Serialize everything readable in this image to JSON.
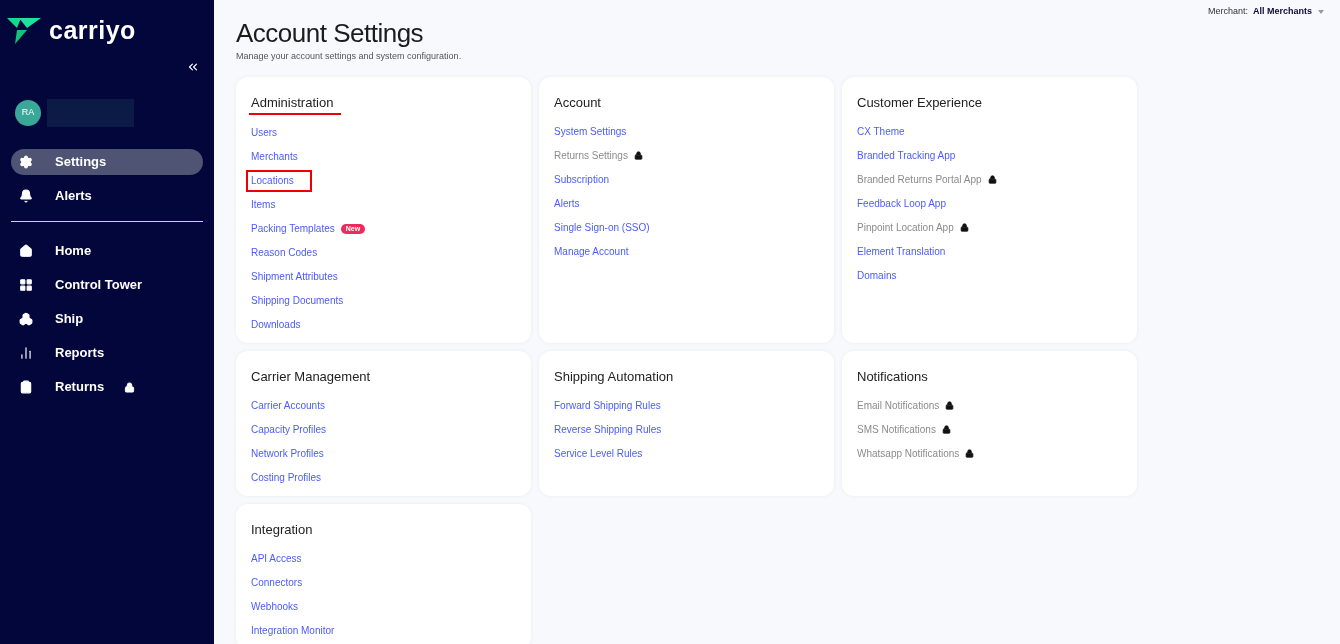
{
  "sidebar": {
    "logo": "carriyo",
    "user": {
      "initials": "RA"
    },
    "top_items": [
      {
        "label": "Settings",
        "selected": true,
        "locked": false
      },
      {
        "label": "Alerts",
        "selected": false,
        "locked": false
      }
    ],
    "items": [
      {
        "label": "Home",
        "selected": false,
        "locked": false
      },
      {
        "label": "Control Tower",
        "selected": false,
        "locked": false
      },
      {
        "label": "Ship",
        "selected": false,
        "locked": false
      },
      {
        "label": "Reports",
        "selected": false,
        "locked": false
      },
      {
        "label": "Returns",
        "selected": false,
        "locked": true
      }
    ]
  },
  "header": {
    "title": "Account Settings",
    "subtitle": "Manage your account settings and system configuration.",
    "merchant_label": "Merchant:",
    "merchant_value": "All Merchants"
  },
  "sections": [
    {
      "title": "Administration",
      "highlighted": true,
      "links": [
        {
          "label": "Users",
          "locked": false,
          "highlighted": false
        },
        {
          "label": "Merchants",
          "locked": false,
          "highlighted": false
        },
        {
          "label": "Locations",
          "locked": false,
          "highlighted": true
        },
        {
          "label": "Items",
          "locked": false,
          "highlighted": false
        },
        {
          "label": "Packing Templates",
          "locked": false,
          "highlighted": false,
          "badge": "New"
        },
        {
          "label": "Reason Codes",
          "locked": false,
          "highlighted": false
        },
        {
          "label": "Shipment Attributes",
          "locked": false,
          "highlighted": false
        },
        {
          "label": "Shipping Documents",
          "locked": false,
          "highlighted": false
        },
        {
          "label": "Downloads",
          "locked": false,
          "highlighted": false
        }
      ]
    },
    {
      "title": "Account",
      "highlighted": false,
      "links": [
        {
          "label": "System Settings",
          "locked": false,
          "highlighted": false
        },
        {
          "label": "Returns Settings",
          "locked": true,
          "highlighted": false
        },
        {
          "label": "Subscription",
          "locked": false,
          "highlighted": false
        },
        {
          "label": "Alerts",
          "locked": false,
          "highlighted": false
        },
        {
          "label": "Single Sign-on (SSO)",
          "locked": false,
          "highlighted": false
        },
        {
          "label": "Manage Account",
          "locked": false,
          "highlighted": false
        }
      ]
    },
    {
      "title": "Customer Experience",
      "highlighted": false,
      "links": [
        {
          "label": "CX Theme",
          "locked": false,
          "highlighted": false
        },
        {
          "label": "Branded Tracking App",
          "locked": false,
          "highlighted": false
        },
        {
          "label": "Branded Returns Portal App",
          "locked": true,
          "highlighted": false
        },
        {
          "label": "Feedback Loop App",
          "locked": false,
          "highlighted": false
        },
        {
          "label": "Pinpoint Location App",
          "locked": true,
          "highlighted": false
        },
        {
          "label": "Element Translation",
          "locked": false,
          "highlighted": false
        },
        {
          "label": "Domains",
          "locked": false,
          "highlighted": false
        }
      ]
    },
    {
      "title": "Carrier Management",
      "highlighted": false,
      "links": [
        {
          "label": "Carrier Accounts",
          "locked": false,
          "highlighted": false
        },
        {
          "label": "Capacity Profiles",
          "locked": false,
          "highlighted": false
        },
        {
          "label": "Network Profiles",
          "locked": false,
          "highlighted": false
        },
        {
          "label": "Costing Profiles",
          "locked": false,
          "highlighted": false
        }
      ]
    },
    {
      "title": "Shipping Automation",
      "highlighted": false,
      "links": [
        {
          "label": "Forward Shipping Rules",
          "locked": false,
          "highlighted": false
        },
        {
          "label": "Reverse Shipping Rules",
          "locked": false,
          "highlighted": false
        },
        {
          "label": "Service Level Rules",
          "locked": false,
          "highlighted": false
        }
      ]
    },
    {
      "title": "Notifications",
      "highlighted": false,
      "links": [
        {
          "label": "Email Notifications",
          "locked": true,
          "highlighted": false
        },
        {
          "label": "SMS Notifications",
          "locked": true,
          "highlighted": false
        },
        {
          "label": "Whatsapp Notifications",
          "locked": true,
          "highlighted": false
        }
      ]
    },
    {
      "title": "Integration",
      "highlighted": false,
      "links": [
        {
          "label": "API Access",
          "locked": false,
          "highlighted": false
        },
        {
          "label": "Connectors",
          "locked": false,
          "highlighted": false
        },
        {
          "label": "Webhooks",
          "locked": false,
          "highlighted": false
        },
        {
          "label": "Integration Monitor",
          "locked": false,
          "highlighted": false
        }
      ]
    }
  ]
}
